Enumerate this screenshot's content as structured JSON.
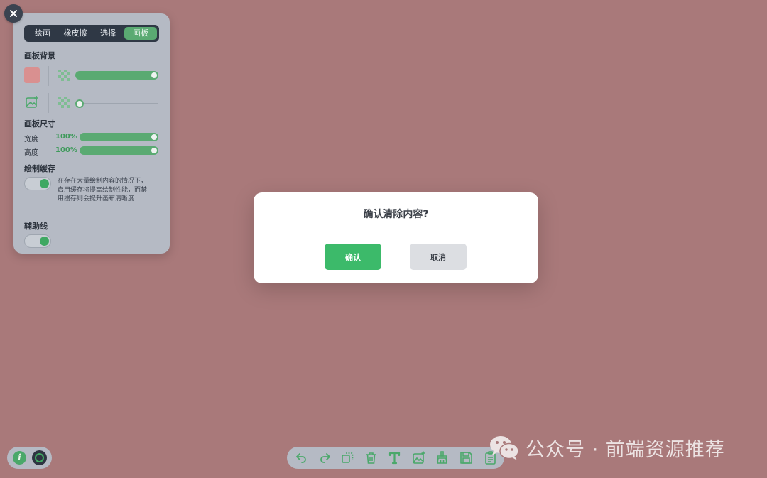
{
  "panel": {
    "tabs": [
      {
        "label": "绘画",
        "active": false
      },
      {
        "label": "橡皮擦",
        "active": false
      },
      {
        "label": "选择",
        "active": false
      },
      {
        "label": "画板",
        "active": true
      }
    ],
    "background": {
      "title": "画板背景",
      "color": "#d99090",
      "color_opacity": 1.0,
      "image_opacity": 0.1
    },
    "size": {
      "title": "画板尺寸",
      "width_label": "宽度",
      "width_value": "100%",
      "height_label": "高度",
      "height_value": "100%"
    },
    "cache": {
      "title": "绘制缓存",
      "enabled": true,
      "description": "在存在大量绘制内容的情况下，启用缓存将提高绘制性能，而禁用缓存则会提升画布清晰度"
    },
    "guides": {
      "title": "辅助线",
      "enabled": true
    }
  },
  "dialog": {
    "title": "确认清除内容?",
    "confirm_label": "确认",
    "cancel_label": "取消"
  },
  "watermark": {
    "text": "公众号 · 前端资源推荐"
  },
  "colors": {
    "canvas": "#a9797a",
    "accent": "#3cba6a",
    "panel": "#b5bac4",
    "dark": "#2f3845"
  },
  "icons": {
    "close": "close-icon",
    "info": "info-icon",
    "toolbar": [
      "undo-icon",
      "redo-icon",
      "copy-icon",
      "trash-icon",
      "text-icon",
      "image-add-icon",
      "clear-brush-icon",
      "save-icon",
      "clipboard-icon"
    ]
  }
}
